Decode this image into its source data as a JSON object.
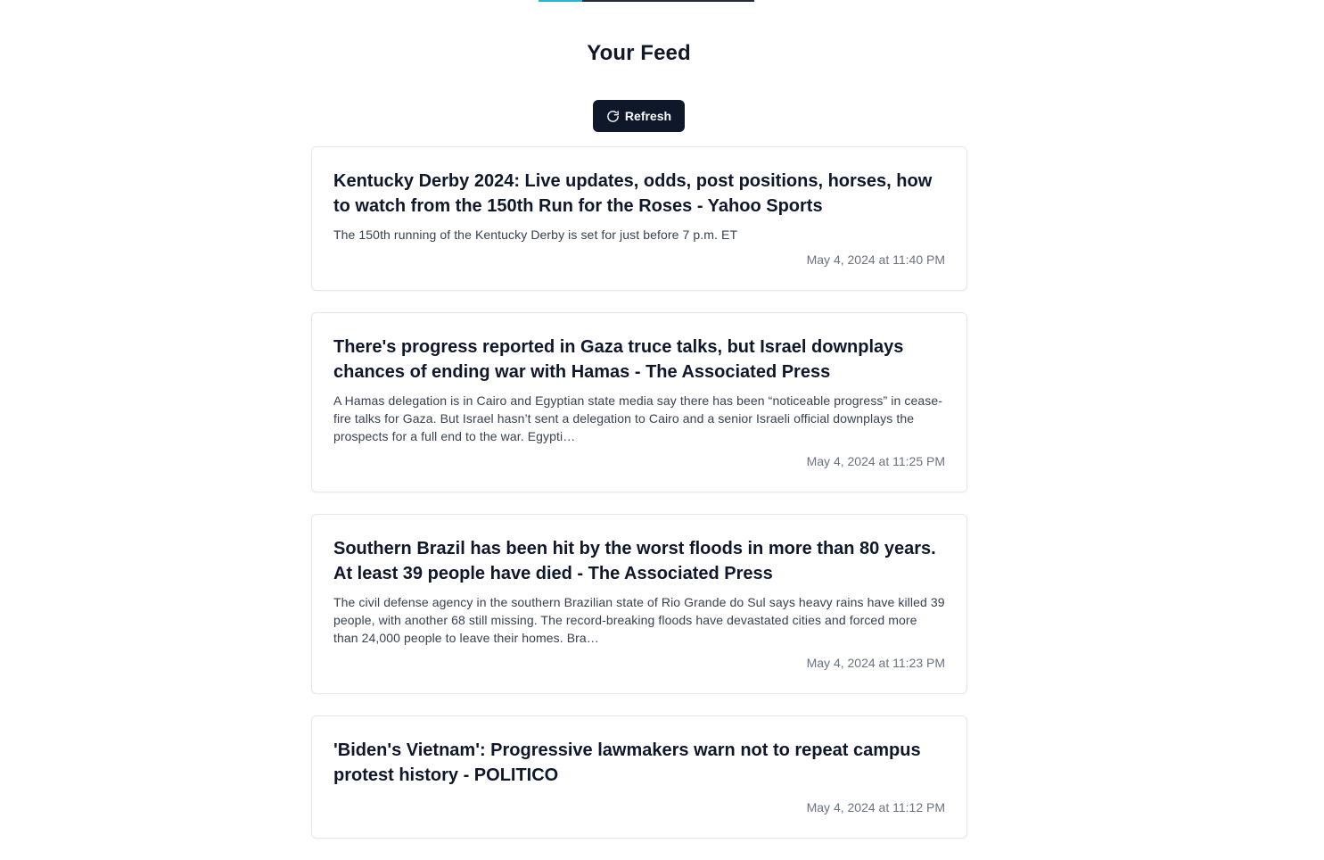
{
  "header": {
    "title": "Your Feed",
    "refresh_label": "Refresh",
    "refresh_icon": "refresh-icon"
  },
  "colors": {
    "button_bg": "#0f172a",
    "accent": "#22b8cf",
    "card_border": "#e5e7eb",
    "date_text": "#6b7280"
  },
  "feed": {
    "items": [
      {
        "title": "Kentucky Derby 2024: Live updates, odds, post positions, horses, how to watch from the 150th Run for the Roses - Yahoo Sports",
        "description": "The 150th running of the Kentucky Derby is set for just before 7 p.m. ET",
        "date": "May 4, 2024 at 11:40 PM"
      },
      {
        "title": "There's progress reported in Gaza truce talks, but Israel downplays chances of ending war with Hamas - The Associated Press",
        "description": "A Hamas delegation is in Cairo and Egyptian state media say there has been “noticeable progress” in cease-fire talks for Gaza. But Israel hasn’t sent a delegation to Cairo and a senior Israeli official downplays the prospects for a full end to the war. Egypti…",
        "date": "May 4, 2024 at 11:25 PM"
      },
      {
        "title": "Southern Brazil has been hit by the worst floods in more than 80 years. At least 39 people have died - The Associated Press",
        "description": "The civil defense agency in the southern Brazilian state of Rio Grande do Sul says heavy rains have killed 39 people, with another 68 still missing. The record-breaking floods have devastated cities and forced more than 24,000 people to leave their homes. Bra…",
        "date": "May 4, 2024 at 11:23 PM"
      },
      {
        "title": "'Biden's Vietnam': Progressive lawmakers warn not to repeat campus protest history - POLITICO",
        "description": "",
        "date": "May 4, 2024 at 11:12 PM"
      }
    ]
  }
}
